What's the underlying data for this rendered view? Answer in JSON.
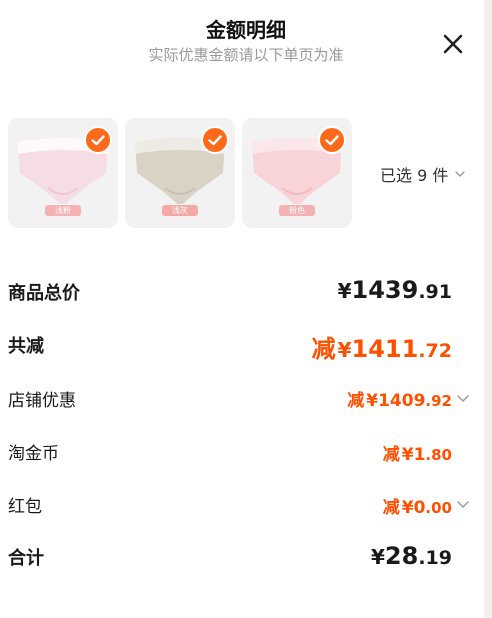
{
  "header": {
    "title": "金额明细",
    "subtitle": "实际优惠金额请以下单页为准"
  },
  "products": [
    {
      "name": "pink-panties",
      "color": "#f6dde4",
      "band": "#ffffff",
      "tag": "浅粉",
      "tag_color": "#f4b1b4"
    },
    {
      "name": "beige-panties",
      "color": "#d8d3c5",
      "band": "#efede6",
      "tag": "浅灰",
      "tag_color": "#f4a9a6"
    },
    {
      "name": "pink2-panties",
      "color": "#f8d3d7",
      "band": "#fbe9ec",
      "tag": "粉色",
      "tag_color": "#f4b1b4"
    }
  ],
  "selected": {
    "label": "已选 9 件"
  },
  "rows": {
    "total_price": {
      "label": "商品总价",
      "cur": "¥",
      "int": "1439",
      "dec": ".91"
    },
    "total_discount": {
      "label": "共减",
      "prefix": "减",
      "cur": "¥",
      "int": "1411",
      "dec": ".72"
    },
    "store_discount": {
      "label": "店铺优惠",
      "prefix": "减",
      "cur": "¥",
      "int": "1409",
      "dec": ".92"
    },
    "taojinbi": {
      "label": "淘金币",
      "prefix": "减",
      "cur": "¥",
      "int": "1",
      "dec": ".80"
    },
    "red_packet": {
      "label": "红包",
      "prefix": "减",
      "cur": "¥",
      "int": "0",
      "dec": ".00"
    },
    "grand_total": {
      "label": "合计",
      "cur": "¥",
      "int": "28",
      "dec": ".19"
    }
  },
  "colors": {
    "accent": "#ff5000",
    "check": "#ff6a1a"
  }
}
